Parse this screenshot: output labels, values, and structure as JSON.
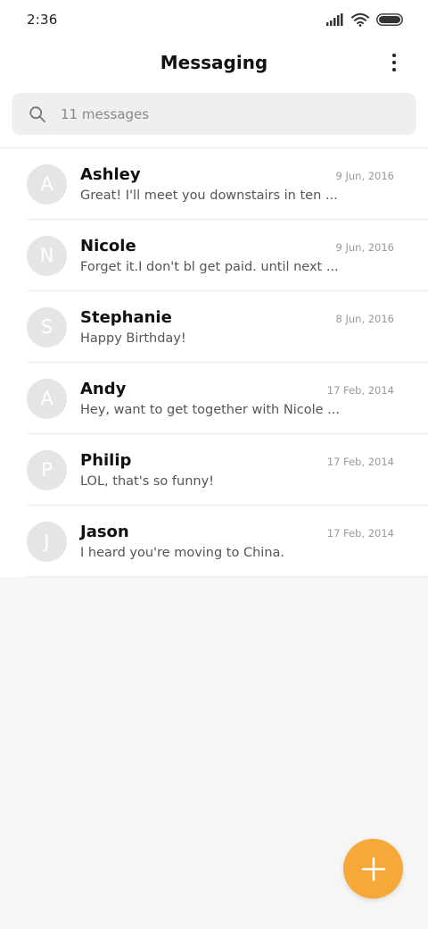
{
  "status_bar": {
    "time": "2:36",
    "icons": [
      "signal-icon",
      "wifi-icon",
      "battery-icon"
    ]
  },
  "header": {
    "title": "Messaging",
    "menu_icon": "more-vertical-icon"
  },
  "search": {
    "placeholder": "11 messages",
    "icon": "search-icon"
  },
  "messages": [
    {
      "initial": "A",
      "name": "Ashley",
      "date": "9 Jun, 2016",
      "preview": "Great! I'll meet you downstairs in ten ..."
    },
    {
      "initial": "N",
      "name": "Nicole",
      "date": "9 Jun, 2016",
      "preview": "Forget it.I don't bl get paid. until next ..."
    },
    {
      "initial": "S",
      "name": "Stephanie",
      "date": "8 Jun, 2016",
      "preview": "Happy Birthday!"
    },
    {
      "initial": "A",
      "name": "Andy",
      "date": "17 Feb, 2014",
      "preview": "Hey, want to get together with Nicole ..."
    },
    {
      "initial": "P",
      "name": "Philip",
      "date": "17 Feb, 2014",
      "preview": "LOL, that's so funny!"
    },
    {
      "initial": "J",
      "name": "Jason",
      "date": "17 Feb, 2014",
      "preview": "I heard you're moving to China."
    }
  ],
  "fab": {
    "icon": "plus-icon"
  },
  "colors": {
    "accent": "#f6a938",
    "avatar_bg": "#e4e5e7",
    "background": "#f6f6f6"
  }
}
